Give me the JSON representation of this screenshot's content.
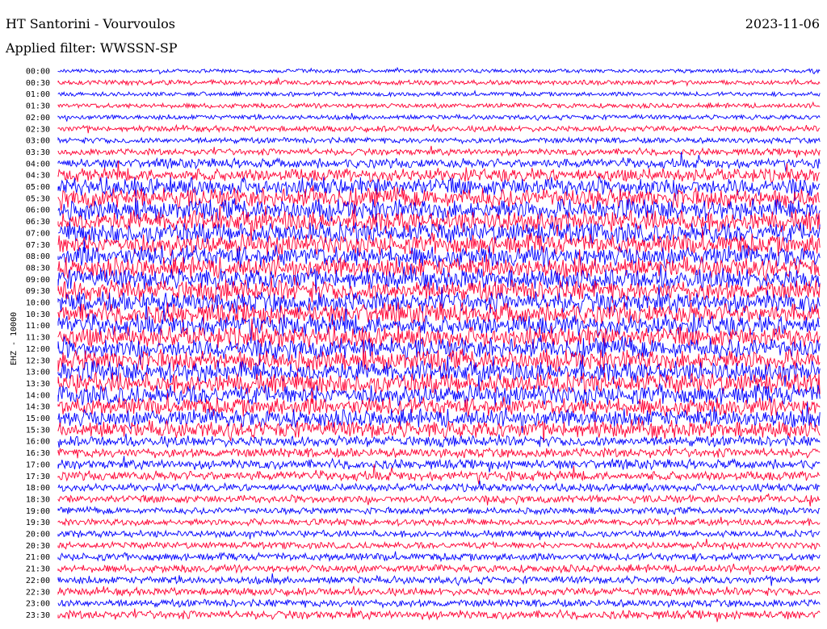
{
  "header": {
    "station": "HT Santorini - Vourvoulos",
    "date": "2023-11-06",
    "filter": "Applied filter: WWSSN-SP"
  },
  "channel_label": "EHZ - 10000",
  "colors": {
    "odd": "#0000ff",
    "even": "#ff0033",
    "background": "#ffffff"
  },
  "chart_data": {
    "type": "line",
    "title": "",
    "xlabel": "",
    "ylabel": "EHZ - 10000",
    "grid": false,
    "series_colors": [
      "#0000ff",
      "#ff0033"
    ],
    "rows": [
      {
        "label": "00:00",
        "amplitude": 0.1
      },
      {
        "label": "00:30",
        "amplitude": 0.15
      },
      {
        "label": "01:00",
        "amplitude": 0.12
      },
      {
        "label": "01:30",
        "amplitude": 0.15
      },
      {
        "label": "02:00",
        "amplitude": 0.15
      },
      {
        "label": "02:30",
        "amplitude": 0.2
      },
      {
        "label": "03:00",
        "amplitude": 0.2
      },
      {
        "label": "03:30",
        "amplitude": 0.25
      },
      {
        "label": "04:00",
        "amplitude": 0.4
      },
      {
        "label": "04:30",
        "amplitude": 0.6
      },
      {
        "label": "05:00",
        "amplitude": 0.85
      },
      {
        "label": "05:30",
        "amplitude": 0.95
      },
      {
        "label": "06:00",
        "amplitude": 1.0
      },
      {
        "label": "06:30",
        "amplitude": 1.0
      },
      {
        "label": "07:00",
        "amplitude": 1.0
      },
      {
        "label": "07:30",
        "amplitude": 1.0
      },
      {
        "label": "08:00",
        "amplitude": 1.0
      },
      {
        "label": "08:30",
        "amplitude": 1.0
      },
      {
        "label": "09:00",
        "amplitude": 1.0
      },
      {
        "label": "09:30",
        "amplitude": 1.0
      },
      {
        "label": "10:00",
        "amplitude": 1.0
      },
      {
        "label": "10:30",
        "amplitude": 1.0
      },
      {
        "label": "11:00",
        "amplitude": 1.0
      },
      {
        "label": "11:30",
        "amplitude": 1.0
      },
      {
        "label": "12:00",
        "amplitude": 1.0
      },
      {
        "label": "12:30",
        "amplitude": 1.0
      },
      {
        "label": "13:00",
        "amplitude": 1.0
      },
      {
        "label": "13:30",
        "amplitude": 1.0
      },
      {
        "label": "14:00",
        "amplitude": 0.95
      },
      {
        "label": "14:30",
        "amplitude": 0.85
      },
      {
        "label": "15:00",
        "amplitude": 0.85
      },
      {
        "label": "15:30",
        "amplitude": 0.8
      },
      {
        "label": "16:00",
        "amplitude": 0.45
      },
      {
        "label": "16:30",
        "amplitude": 0.4
      },
      {
        "label": "17:00",
        "amplitude": 0.4
      },
      {
        "label": "17:30",
        "amplitude": 0.4
      },
      {
        "label": "18:00",
        "amplitude": 0.3
      },
      {
        "label": "18:30",
        "amplitude": 0.3
      },
      {
        "label": "19:00",
        "amplitude": 0.25
      },
      {
        "label": "19:30",
        "amplitude": 0.25
      },
      {
        "label": "20:00",
        "amplitude": 0.25
      },
      {
        "label": "20:30",
        "amplitude": 0.25
      },
      {
        "label": "21:00",
        "amplitude": 0.3
      },
      {
        "label": "21:30",
        "amplitude": 0.3
      },
      {
        "label": "22:00",
        "amplitude": 0.3
      },
      {
        "label": "22:30",
        "amplitude": 0.3
      },
      {
        "label": "23:00",
        "amplitude": 0.3
      },
      {
        "label": "23:30",
        "amplitude": 0.35
      }
    ]
  }
}
